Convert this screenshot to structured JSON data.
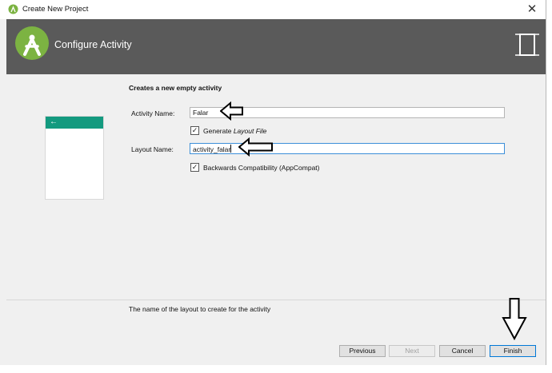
{
  "window": {
    "title": "Create New Project",
    "close_glyph": "✕"
  },
  "banner": {
    "title": "Configure Activity",
    "brand_color": "#5a5a5a"
  },
  "preview": {
    "back_glyph": "←",
    "accent": "#139a7f"
  },
  "form": {
    "heading": "Creates a new empty activity",
    "activity_name_label": "Activity Name:",
    "activity_name_value": "Falar",
    "generate_layout_prefix": "Generate ",
    "generate_layout_italic": "Layout File",
    "generate_layout_checked": true,
    "layout_name_label": "Layout Name:",
    "layout_name_value": "activity_falar",
    "backwards_compat_label": "Backwards Compatibility (AppCompat)",
    "backwards_compat_checked": true
  },
  "hint": {
    "text": "The name of the layout to create for the activity"
  },
  "footer": {
    "previous_label": "Previous",
    "next_label": "Next",
    "cancel_label": "Cancel",
    "finish_label": "Finish"
  }
}
